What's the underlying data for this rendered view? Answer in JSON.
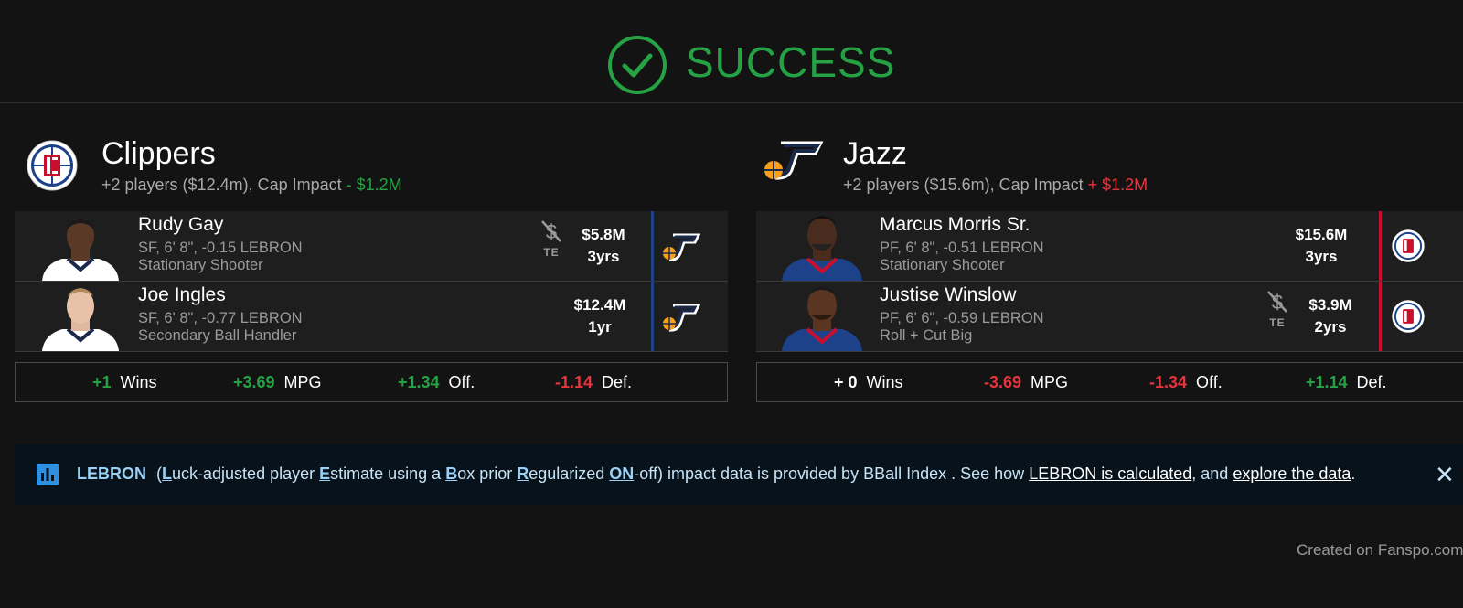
{
  "header": {
    "status_text": "SUCCESS",
    "status_icon": "check-circle-icon",
    "status_color": "#25a244"
  },
  "teams": [
    {
      "name": "Clippers",
      "summary_prefix": "+2 players ($12.4m), Cap Impact ",
      "cap_impact": "- $1.2M",
      "logo": "clippers-logo",
      "receives": [
        {
          "name": "Rudy Gay",
          "info": "SF, 6' 8\", -0.15 LEBRON",
          "role": "Stationary Shooter",
          "te": true,
          "te_label": "TE",
          "salary": "$5.8M",
          "years": "3yrs",
          "from_logo": "jazz-logo"
        },
        {
          "name": "Joe Ingles",
          "info": "SF, 6' 8\", -0.77 LEBRON",
          "role": "Secondary Ball Handler",
          "te": false,
          "salary": "$12.4M",
          "years": "1yr",
          "from_logo": "jazz-logo"
        }
      ],
      "stats": [
        {
          "value": "+1",
          "label": "Wins",
          "tone": "green"
        },
        {
          "value": "+3.69",
          "label": "MPG",
          "tone": "green"
        },
        {
          "value": "+1.34",
          "label": "Off.",
          "tone": "green"
        },
        {
          "value": "-1.14",
          "label": "Def.",
          "tone": "red"
        }
      ]
    },
    {
      "name": "Jazz",
      "summary_prefix": "+2 players ($15.6m), Cap Impact ",
      "cap_impact": "+ $1.2M",
      "logo": "jazz-logo",
      "receives": [
        {
          "name": "Marcus Morris Sr.",
          "info": "PF, 6' 8\", -0.51 LEBRON",
          "role": "Stationary Shooter",
          "te": false,
          "salary": "$15.6M",
          "years": "3yrs",
          "from_logo": "clippers-logo"
        },
        {
          "name": "Justise Winslow",
          "info": "PF, 6' 6\", -0.59 LEBRON",
          "role": "Roll + Cut Big",
          "te": true,
          "te_label": "TE",
          "salary": "$3.9M",
          "years": "2yrs",
          "from_logo": "clippers-logo"
        }
      ],
      "stats": [
        {
          "value": "+ 0",
          "label": "Wins",
          "tone": "white"
        },
        {
          "value": "-3.69",
          "label": "MPG",
          "tone": "red"
        },
        {
          "value": "-1.34",
          "label": "Off.",
          "tone": "red"
        },
        {
          "value": "+1.14",
          "label": "Def.",
          "tone": "green"
        }
      ]
    }
  ],
  "info_banner": {
    "title": "LEBRON",
    "text_open": "(",
    "L": "L",
    "t1": "uck-adjusted player ",
    "E": "E",
    "t2": "stimate using a ",
    "B": "B",
    "t3": "ox prior ",
    "R": "R",
    "t4": "egularized ",
    "ON": "ON",
    "t5": "-off) impact data is provided by BBall Index . See how ",
    "link1": "LEBRON is calculated",
    "t6": ", and ",
    "link2": "explore the data",
    "t7": ".",
    "close": "✕"
  },
  "footer": {
    "text": "Created on Fanspo.com"
  }
}
